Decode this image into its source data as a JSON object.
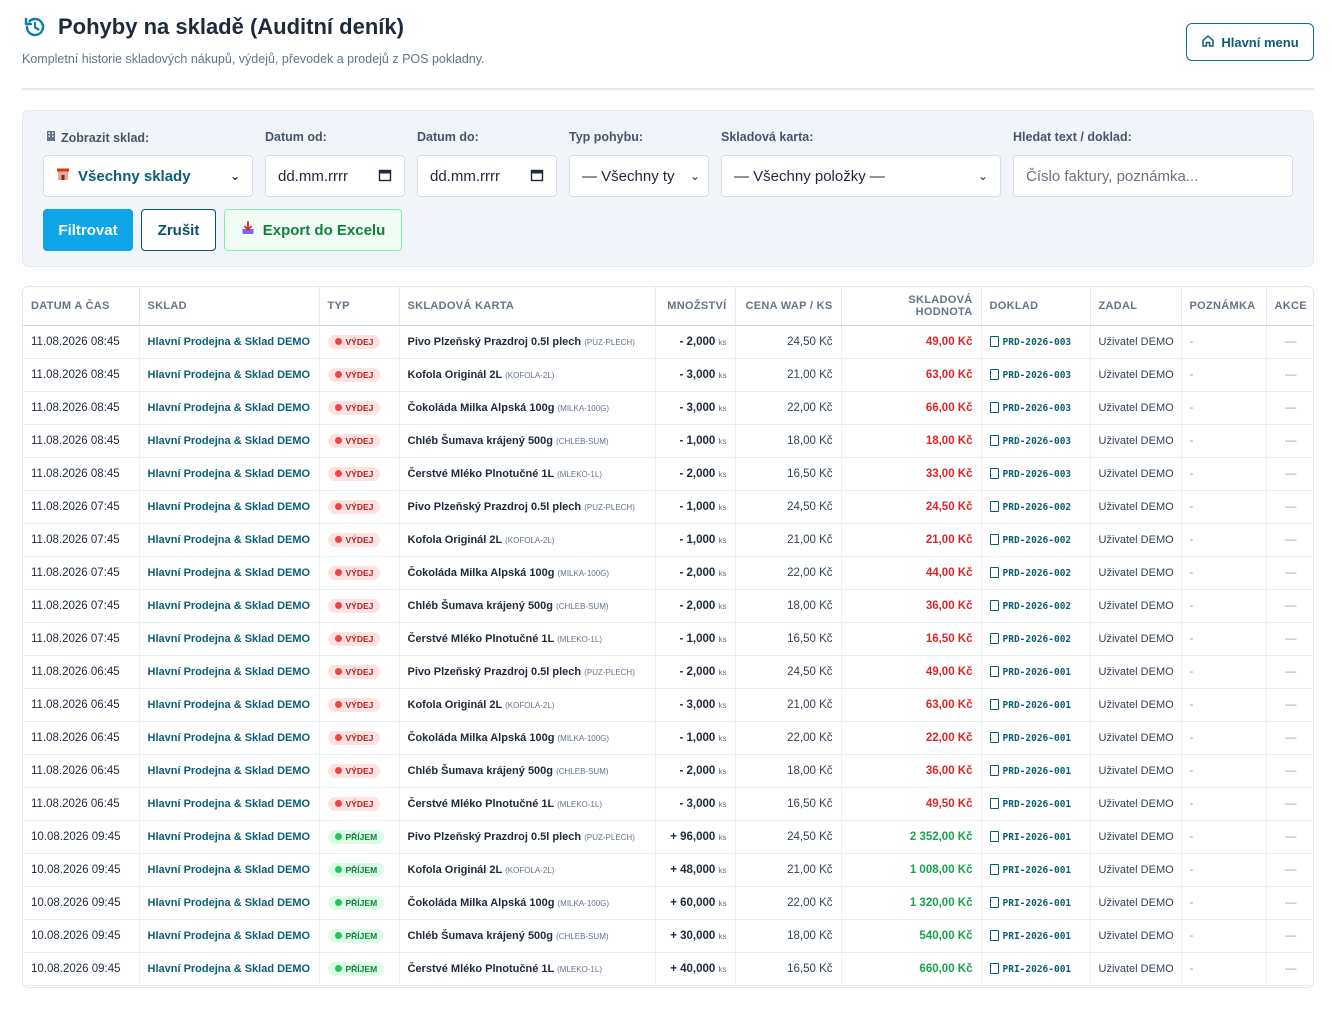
{
  "header": {
    "title": "Pohyby na skladě (Auditní deník)",
    "subtitle": "Kompletní historie skladových nákupů, výdejů, převodek a prodejů z POS pokladny.",
    "menu_button": "Hlavní menu"
  },
  "filters": {
    "store_label": "Zobrazit sklad:",
    "store_value": "Všechny sklady",
    "date_from_label": "Datum od:",
    "date_from_placeholder": "dd.mm.rrrr",
    "date_to_label": "Datum do:",
    "date_to_placeholder": "dd.mm.rrrr",
    "type_label": "Typ pohybu:",
    "type_value": "— Všechny ty",
    "card_label": "Skladová karta:",
    "card_value": "— Všechny položky —",
    "search_label": "Hledat text / doklad:",
    "search_placeholder": "Číslo faktury, poznámka...",
    "filter_button": "Filtrovat",
    "cancel_button": "Zrušit",
    "export_button": "Export do Excelu"
  },
  "table": {
    "columns": [
      "DATUM A ČAS",
      "SKLAD",
      "TYP",
      "SKLADOVÁ KARTA",
      "MNOŽSTVÍ",
      "CENA WAP / KS",
      "SKLADOVÁ HODNOTA",
      "DOKLAD",
      "ZADAL",
      "POZNÁMKA",
      "AKCE"
    ],
    "unit": "ks",
    "rows": [
      {
        "date": "11.08.2026 08:45",
        "store": "Hlavní Prodejna & Sklad DEMO",
        "type": "VÝDEJ",
        "item": "Pivo Plzeňský Prazdroj 0.5l plech",
        "code": "(PUZ-PLECH)",
        "qty": "- 2,000",
        "price": "24,50 Kč",
        "value": "49,00 Kč",
        "doc": "PRD-2026-003",
        "user": "Uživatel DEMO",
        "note": "-",
        "action": "—"
      },
      {
        "date": "11.08.2026 08:45",
        "store": "Hlavní Prodejna & Sklad DEMO",
        "type": "VÝDEJ",
        "item": "Kofola Originál 2L",
        "code": "(KOFOLA-2L)",
        "qty": "- 3,000",
        "price": "21,00 Kč",
        "value": "63,00 Kč",
        "doc": "PRD-2026-003",
        "user": "Uživatel DEMO",
        "note": "-",
        "action": "—"
      },
      {
        "date": "11.08.2026 08:45",
        "store": "Hlavní Prodejna & Sklad DEMO",
        "type": "VÝDEJ",
        "item": "Čokoláda Milka Alpská 100g",
        "code": "(MILKA-100G)",
        "qty": "- 3,000",
        "price": "22,00 Kč",
        "value": "66,00 Kč",
        "doc": "PRD-2026-003",
        "user": "Uživatel DEMO",
        "note": "-",
        "action": "—"
      },
      {
        "date": "11.08.2026 08:45",
        "store": "Hlavní Prodejna & Sklad DEMO",
        "type": "VÝDEJ",
        "item": "Chléb Šumava krájený 500g",
        "code": "(CHLEB-SUM)",
        "qty": "- 1,000",
        "price": "18,00 Kč",
        "value": "18,00 Kč",
        "doc": "PRD-2026-003",
        "user": "Uživatel DEMO",
        "note": "-",
        "action": "—"
      },
      {
        "date": "11.08.2026 08:45",
        "store": "Hlavní Prodejna & Sklad DEMO",
        "type": "VÝDEJ",
        "item": "Čerstvé Mléko Plnotučné 1L",
        "code": "(MLEKO-1L)",
        "qty": "- 2,000",
        "price": "16,50 Kč",
        "value": "33,00 Kč",
        "doc": "PRD-2026-003",
        "user": "Uživatel DEMO",
        "note": "-",
        "action": "—"
      },
      {
        "date": "11.08.2026 07:45",
        "store": "Hlavní Prodejna & Sklad DEMO",
        "type": "VÝDEJ",
        "item": "Pivo Plzeňský Prazdroj 0.5l plech",
        "code": "(PUZ-PLECH)",
        "qty": "- 1,000",
        "price": "24,50 Kč",
        "value": "24,50 Kč",
        "doc": "PRD-2026-002",
        "user": "Uživatel DEMO",
        "note": "-",
        "action": "—"
      },
      {
        "date": "11.08.2026 07:45",
        "store": "Hlavní Prodejna & Sklad DEMO",
        "type": "VÝDEJ",
        "item": "Kofola Originál 2L",
        "code": "(KOFOLA-2L)",
        "qty": "- 1,000",
        "price": "21,00 Kč",
        "value": "21,00 Kč",
        "doc": "PRD-2026-002",
        "user": "Uživatel DEMO",
        "note": "-",
        "action": "—"
      },
      {
        "date": "11.08.2026 07:45",
        "store": "Hlavní Prodejna & Sklad DEMO",
        "type": "VÝDEJ",
        "item": "Čokoláda Milka Alpská 100g",
        "code": "(MILKA-100G)",
        "qty": "- 2,000",
        "price": "22,00 Kč",
        "value": "44,00 Kč",
        "doc": "PRD-2026-002",
        "user": "Uživatel DEMO",
        "note": "-",
        "action": "—"
      },
      {
        "date": "11.08.2026 07:45",
        "store": "Hlavní Prodejna & Sklad DEMO",
        "type": "VÝDEJ",
        "item": "Chléb Šumava krájený 500g",
        "code": "(CHLEB-SUM)",
        "qty": "- 2,000",
        "price": "18,00 Kč",
        "value": "36,00 Kč",
        "doc": "PRD-2026-002",
        "user": "Uživatel DEMO",
        "note": "-",
        "action": "—"
      },
      {
        "date": "11.08.2026 07:45",
        "store": "Hlavní Prodejna & Sklad DEMO",
        "type": "VÝDEJ",
        "item": "Čerstvé Mléko Plnotučné 1L",
        "code": "(MLEKO-1L)",
        "qty": "- 1,000",
        "price": "16,50 Kč",
        "value": "16,50 Kč",
        "doc": "PRD-2026-002",
        "user": "Uživatel DEMO",
        "note": "-",
        "action": "—"
      },
      {
        "date": "11.08.2026 06:45",
        "store": "Hlavní Prodejna & Sklad DEMO",
        "type": "VÝDEJ",
        "item": "Pivo Plzeňský Prazdroj 0.5l plech",
        "code": "(PUZ-PLECH)",
        "qty": "- 2,000",
        "price": "24,50 Kč",
        "value": "49,00 Kč",
        "doc": "PRD-2026-001",
        "user": "Uživatel DEMO",
        "note": "-",
        "action": "—"
      },
      {
        "date": "11.08.2026 06:45",
        "store": "Hlavní Prodejna & Sklad DEMO",
        "type": "VÝDEJ",
        "item": "Kofola Originál 2L",
        "code": "(KOFOLA-2L)",
        "qty": "- 3,000",
        "price": "21,00 Kč",
        "value": "63,00 Kč",
        "doc": "PRD-2026-001",
        "user": "Uživatel DEMO",
        "note": "-",
        "action": "—"
      },
      {
        "date": "11.08.2026 06:45",
        "store": "Hlavní Prodejna & Sklad DEMO",
        "type": "VÝDEJ",
        "item": "Čokoláda Milka Alpská 100g",
        "code": "(MILKA-100G)",
        "qty": "- 1,000",
        "price": "22,00 Kč",
        "value": "22,00 Kč",
        "doc": "PRD-2026-001",
        "user": "Uživatel DEMO",
        "note": "-",
        "action": "—"
      },
      {
        "date": "11.08.2026 06:45",
        "store": "Hlavní Prodejna & Sklad DEMO",
        "type": "VÝDEJ",
        "item": "Chléb Šumava krájený 500g",
        "code": "(CHLEB-SUM)",
        "qty": "- 2,000",
        "price": "18,00 Kč",
        "value": "36,00 Kč",
        "doc": "PRD-2026-001",
        "user": "Uživatel DEMO",
        "note": "-",
        "action": "—"
      },
      {
        "date": "11.08.2026 06:45",
        "store": "Hlavní Prodejna & Sklad DEMO",
        "type": "VÝDEJ",
        "item": "Čerstvé Mléko Plnotučné 1L",
        "code": "(MLEKO-1L)",
        "qty": "- 3,000",
        "price": "16,50 Kč",
        "value": "49,50 Kč",
        "doc": "PRD-2026-001",
        "user": "Uživatel DEMO",
        "note": "-",
        "action": "—"
      },
      {
        "date": "10.08.2026 09:45",
        "store": "Hlavní Prodejna & Sklad DEMO",
        "type": "PŘÍJEM",
        "item": "Pivo Plzeňský Prazdroj 0.5l plech",
        "code": "(PUZ-PLECH)",
        "qty": "+ 96,000",
        "price": "24,50 Kč",
        "value": "2 352,00 Kč",
        "doc": "PRI-2026-001",
        "user": "Uživatel DEMO",
        "note": "-",
        "action": "—"
      },
      {
        "date": "10.08.2026 09:45",
        "store": "Hlavní Prodejna & Sklad DEMO",
        "type": "PŘÍJEM",
        "item": "Kofola Originál 2L",
        "code": "(KOFOLA-2L)",
        "qty": "+ 48,000",
        "price": "21,00 Kč",
        "value": "1 008,00 Kč",
        "doc": "PRI-2026-001",
        "user": "Uživatel DEMO",
        "note": "-",
        "action": "—"
      },
      {
        "date": "10.08.2026 09:45",
        "store": "Hlavní Prodejna & Sklad DEMO",
        "type": "PŘÍJEM",
        "item": "Čokoláda Milka Alpská 100g",
        "code": "(MILKA-100G)",
        "qty": "+ 60,000",
        "price": "22,00 Kč",
        "value": "1 320,00 Kč",
        "doc": "PRI-2026-001",
        "user": "Uživatel DEMO",
        "note": "-",
        "action": "—"
      },
      {
        "date": "10.08.2026 09:45",
        "store": "Hlavní Prodejna & Sklad DEMO",
        "type": "PŘÍJEM",
        "item": "Chléb Šumava krájený 500g",
        "code": "(CHLEB-SUM)",
        "qty": "+ 30,000",
        "price": "18,00 Kč",
        "value": "540,00 Kč",
        "doc": "PRI-2026-001",
        "user": "Uživatel DEMO",
        "note": "-",
        "action": "—"
      },
      {
        "date": "10.08.2026 09:45",
        "store": "Hlavní Prodejna & Sklad DEMO",
        "type": "PŘÍJEM",
        "item": "Čerstvé Mléko Plnotučné 1L",
        "code": "(MLEKO-1L)",
        "qty": "+ 40,000",
        "price": "16,50 Kč",
        "value": "660,00 Kč",
        "doc": "PRI-2026-001",
        "user": "Uživatel DEMO",
        "note": "-",
        "action": "—"
      }
    ]
  },
  "colors": {
    "accent": "#0ea5e9",
    "link": "#0b5f75",
    "negative": "#dc2626",
    "positive": "#16a34a"
  }
}
